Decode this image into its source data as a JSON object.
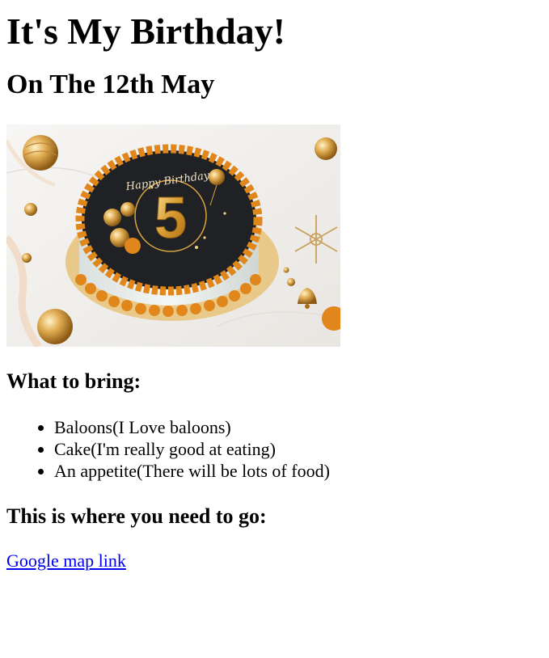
{
  "page": {
    "title": "It's My Birthday!",
    "date_heading": "On The 12th May",
    "image": {
      "inscription": "Happy Birthday",
      "number": "5",
      "colors": {
        "frosting": "#e0861a",
        "cake_top": "#1f2124",
        "cake_side": "#eef2ef",
        "gold": "#d9a441",
        "marble": "#f3f1ef",
        "plate": "#e8c98a"
      }
    },
    "bring_heading": "What to bring:",
    "bring_items": [
      "Baloons(I Love baloons)",
      "Cake(I'm really good at eating)",
      "An appetite(There will be lots of food)"
    ],
    "where_heading": "This is where you need to go:",
    "map_link_text": "Google map link",
    "link_color": "#0000ee"
  }
}
